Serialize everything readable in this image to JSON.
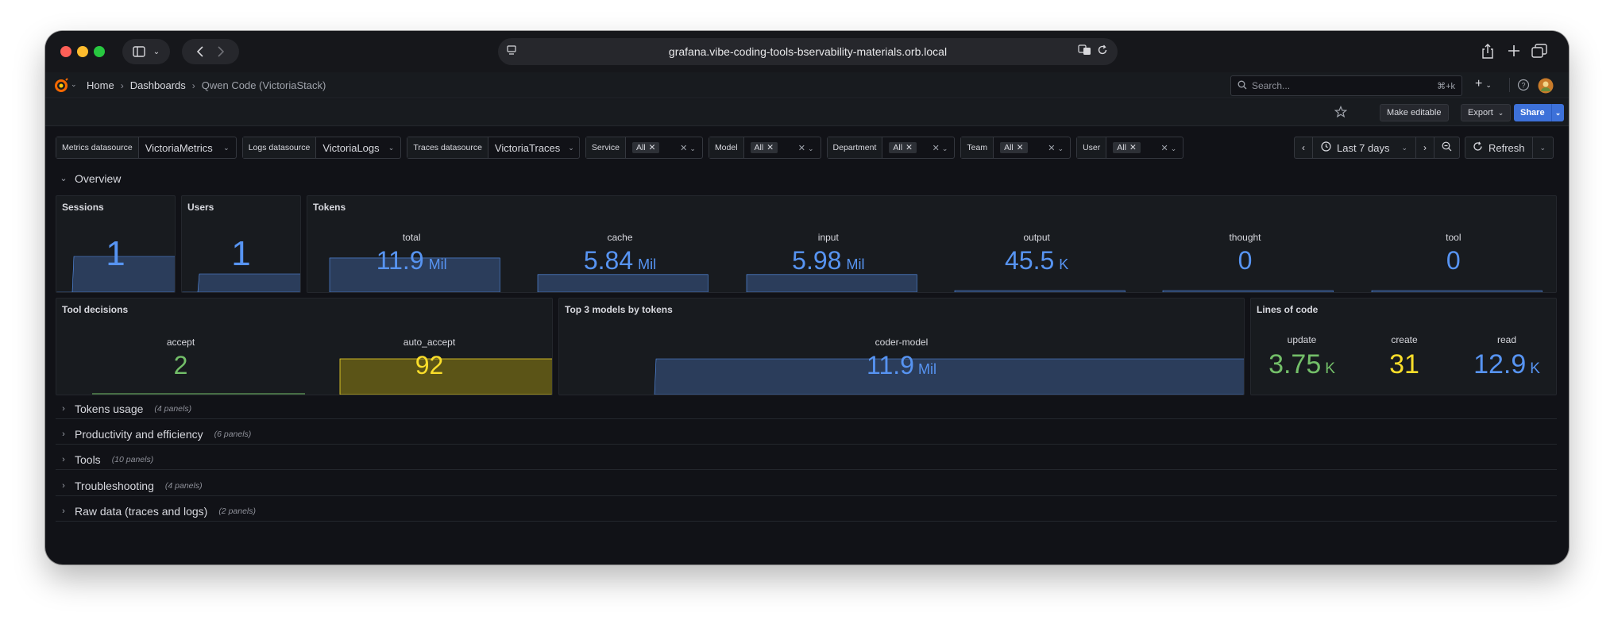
{
  "browser": {
    "url": "grafana.vibe-coding-tools-bservability-materials.orb.local"
  },
  "nav": {
    "breadcrumbs": [
      "Home",
      "Dashboards",
      "Qwen Code (VictoriaStack)"
    ],
    "search_placeholder": "Search...",
    "search_shortcut": "⌘+k"
  },
  "toolbar": {
    "make_editable": "Make editable",
    "export": "Export",
    "share": "Share"
  },
  "variables": [
    {
      "label": "Metrics datasource",
      "value": "VictoriaMetrics",
      "type": "select"
    },
    {
      "label": "Logs datasource",
      "value": "VictoriaLogs",
      "type": "select"
    },
    {
      "label": "Traces datasource",
      "value": "VictoriaTraces",
      "type": "select"
    },
    {
      "label": "Service",
      "value": "All",
      "type": "multi"
    },
    {
      "label": "Model",
      "value": "All",
      "type": "multi"
    },
    {
      "label": "Department",
      "value": "All",
      "type": "multi"
    },
    {
      "label": "Team",
      "value": "All",
      "type": "multi"
    },
    {
      "label": "User",
      "value": "All",
      "type": "multi"
    }
  ],
  "time": {
    "range": "Last 7 days",
    "refresh": "Refresh"
  },
  "rows": {
    "overview": "Overview",
    "collapsed": [
      {
        "title": "Tokens usage",
        "count": "(4 panels)"
      },
      {
        "title": "Productivity and efficiency",
        "count": "(6 panels)"
      },
      {
        "title": "Tools",
        "count": "(10 panels)"
      },
      {
        "title": "Troubleshooting",
        "count": "(4 panels)"
      },
      {
        "title": "Raw data (traces and logs)",
        "count": "(2 panels)"
      }
    ]
  },
  "panels": {
    "sessions": {
      "title": "Sessions",
      "value": "1"
    },
    "users": {
      "title": "Users",
      "value": "1"
    },
    "tokens": {
      "title": "Tokens",
      "stats": [
        {
          "name": "total",
          "value": "11.9",
          "unit": "Mil",
          "fill": 0.35
        },
        {
          "name": "cache",
          "value": "5.84",
          "unit": "Mil",
          "fill": 0.18
        },
        {
          "name": "input",
          "value": "5.98",
          "unit": "Mil",
          "fill": 0.18
        },
        {
          "name": "output",
          "value": "45.5",
          "unit": "K",
          "fill": 0.01
        },
        {
          "name": "thought",
          "value": "0",
          "unit": "",
          "fill": 0.01
        },
        {
          "name": "tool",
          "value": "0",
          "unit": "",
          "fill": 0.01
        }
      ]
    },
    "tool_decisions": {
      "title": "Tool decisions",
      "stats": [
        {
          "name": "accept",
          "value": "2",
          "color": "#73bf69"
        },
        {
          "name": "auto_accept",
          "value": "92",
          "color": "#fade2a"
        }
      ]
    },
    "top_models": {
      "title": "Top 3 models by tokens",
      "stats": [
        {
          "name": "coder-model",
          "value": "11.9",
          "unit": "Mil"
        }
      ]
    },
    "lines_of_code": {
      "title": "Lines of code",
      "stats": [
        {
          "name": "update",
          "value": "3.75",
          "unit": "K",
          "color": "#73bf69"
        },
        {
          "name": "create",
          "value": "31",
          "unit": "",
          "color": "#fade2a"
        },
        {
          "name": "read",
          "value": "12.9",
          "unit": "K",
          "color": "#5794f2"
        }
      ]
    }
  },
  "colors": {
    "blue": "#5794f2",
    "green": "#73bf69",
    "yellow": "#fade2a",
    "primary": "#3d71d9"
  }
}
